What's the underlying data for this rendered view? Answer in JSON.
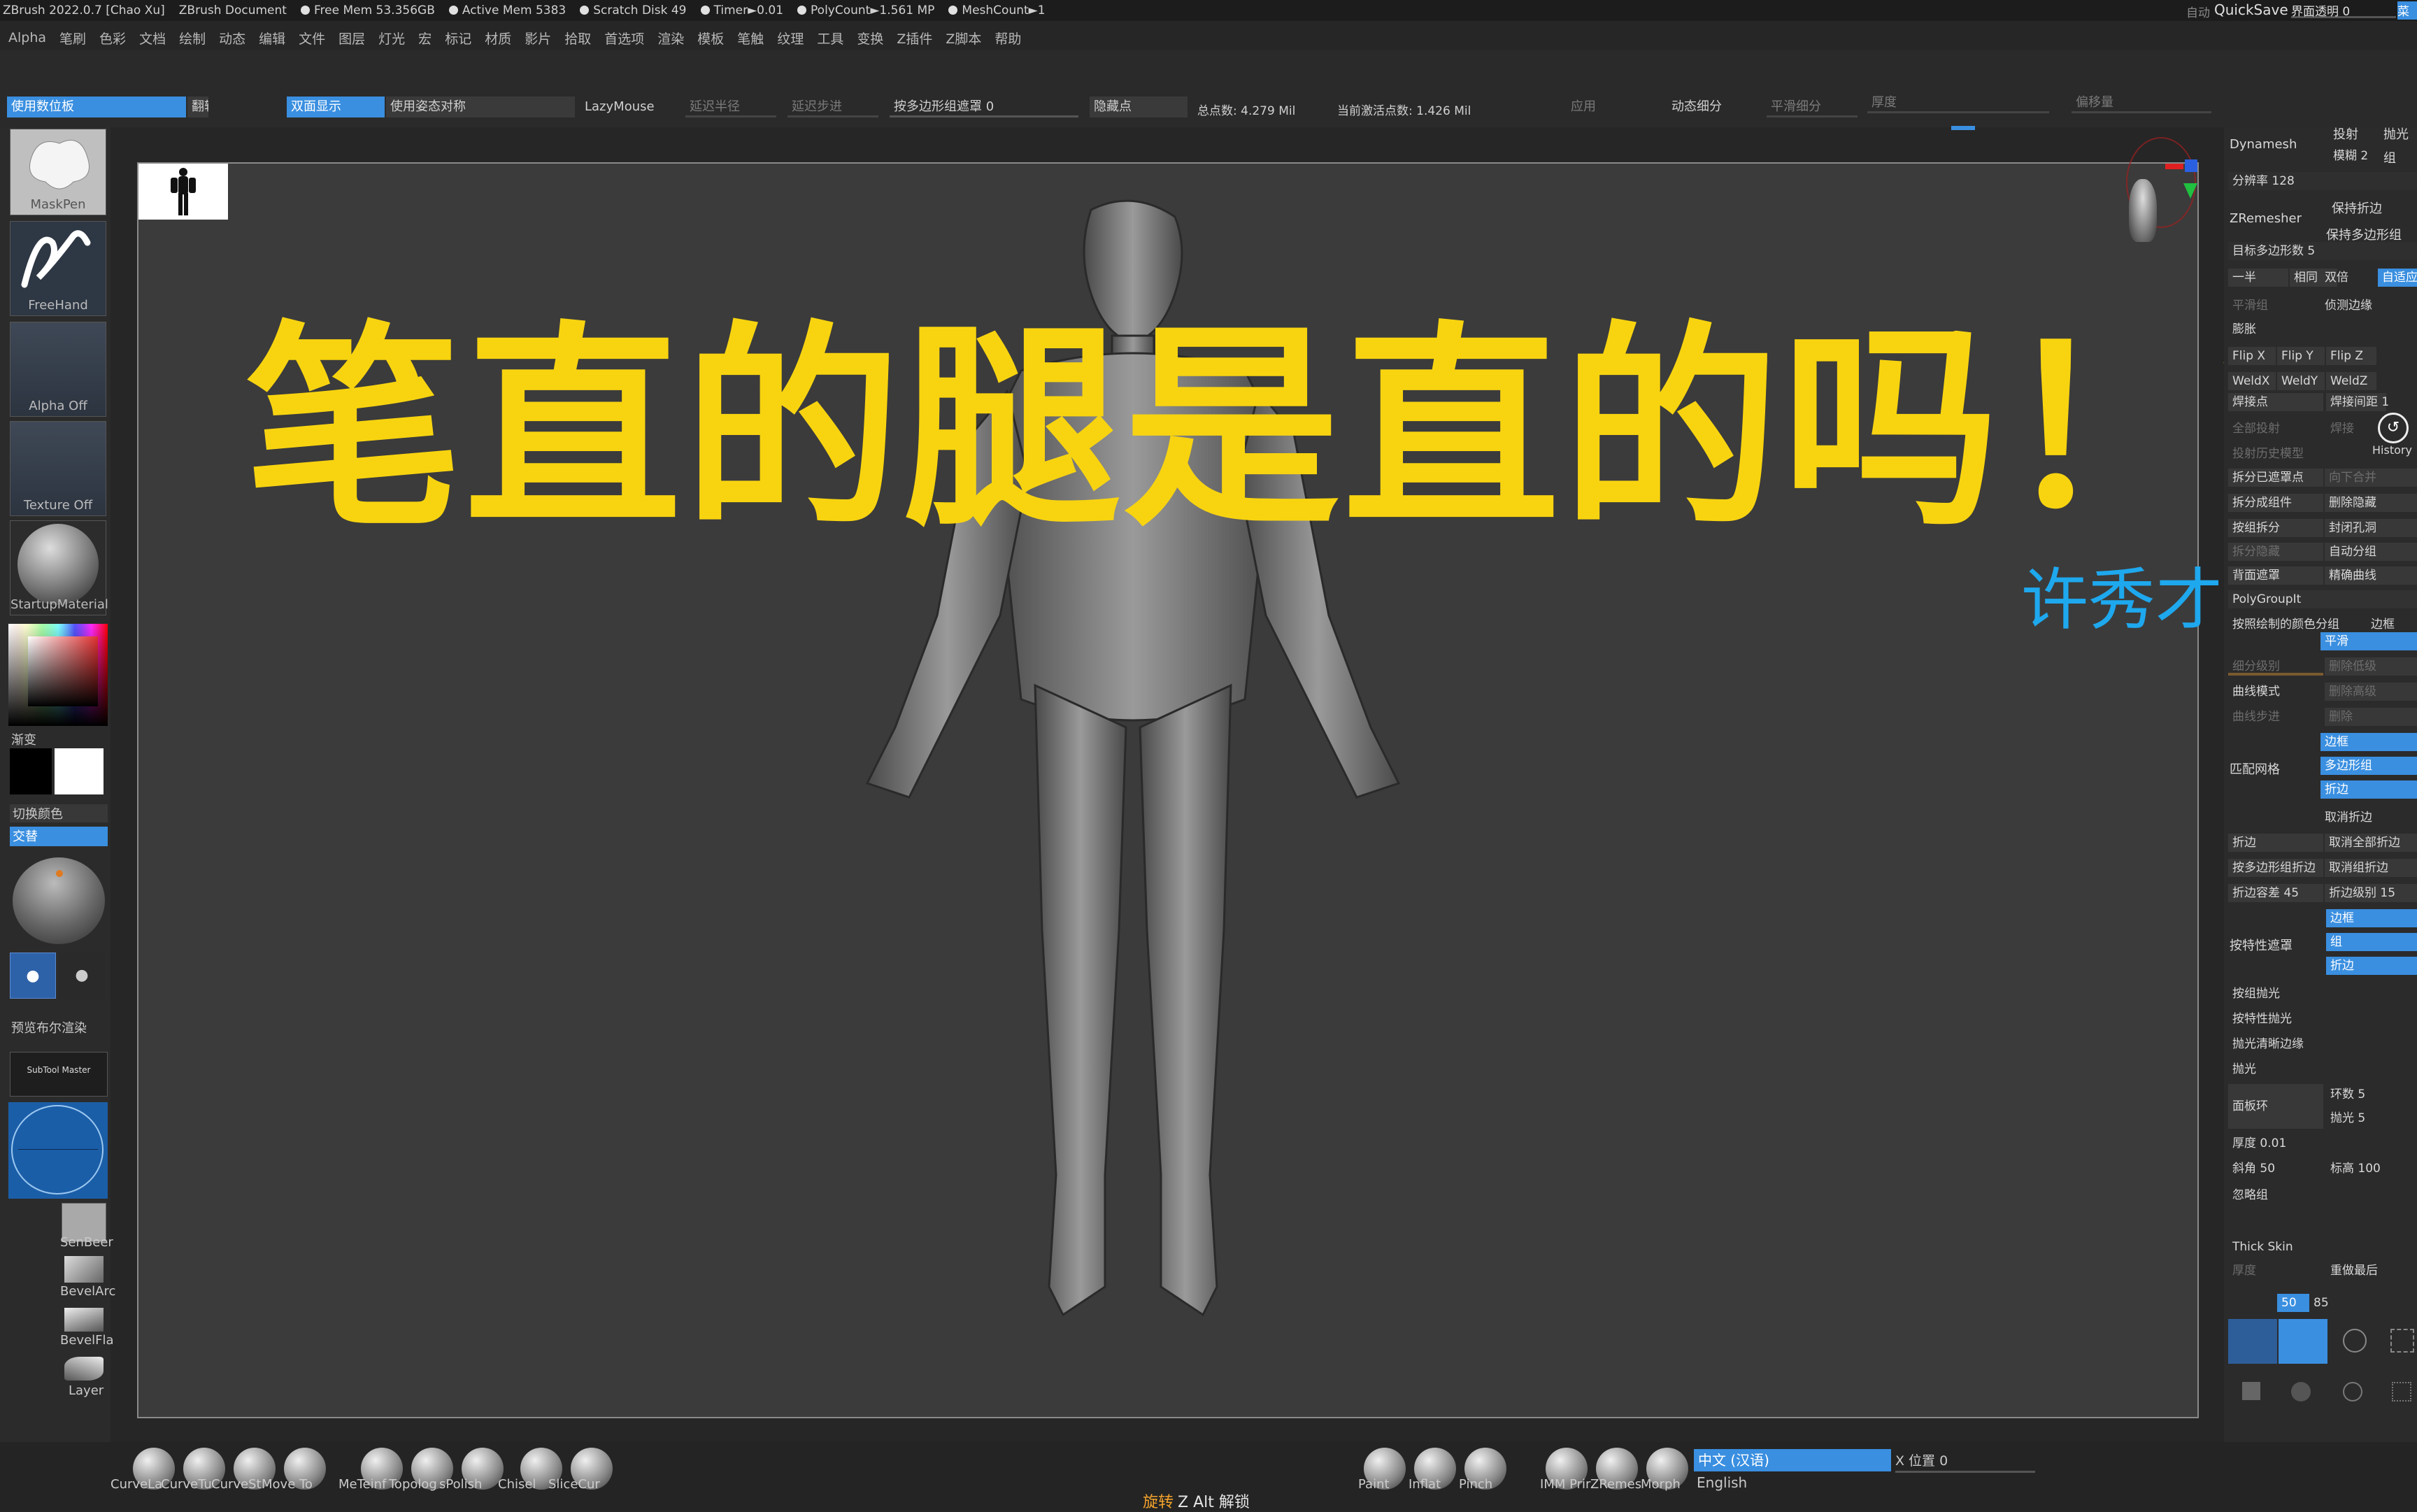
{
  "titlebar": {
    "app": "ZBrush 2022.0.7 [Chao Xu]",
    "document": "ZBrush Document",
    "free_mem": "Free Mem 53.356GB",
    "active_mem": "Active Mem 5383",
    "scratch_disk": "Scratch Disk 49",
    "timer": "Timer►0.01",
    "polycount": "PolyCount►1.561 MP",
    "meshcount": "MeshCount►1",
    "right_a": "自动",
    "quicksave": "QuickSave",
    "transparency": "界面透明 0",
    "menu": "菜单"
  },
  "menubar": [
    "Alpha",
    "笔刷",
    "色彩",
    "文档",
    "绘制",
    "动态",
    "编辑",
    "文件",
    "图层",
    "灯光",
    "宏",
    "标记",
    "材质",
    "影片",
    "拾取",
    "首选项",
    "渲染",
    "模板",
    "笔触",
    "纹理",
    "工具",
    "变换",
    "Z插件",
    "Z脚本",
    "帮助"
  ],
  "topshelf": {
    "use_tablet": "使用数位板",
    "flip": "翻转",
    "double_sided": "双面显示",
    "use_pose_sym": "使用姿态对称",
    "lazymouse": "LazyMouse",
    "lazy_radius": "延迟半径",
    "lazy_step": "延迟步进",
    "polygroup_mask": "按多边形组遮罩 0",
    "hide_points": "隐藏点",
    "total_points": "总点数: 4.279 Mil",
    "active_points": "当前激活点数: 1.426 Mil",
    "apply": "应用",
    "dynamic_subdiv": "动态细分",
    "smooth_subdiv": "平滑细分",
    "thickness": "厚度",
    "offset": "偏移量"
  },
  "leftpanel": {
    "brush1": "MaskPen",
    "brush2": "FreeHand",
    "alpha": "Alpha Off",
    "texture": "Texture Off",
    "material": "StartupMaterial",
    "gradient": "渐变",
    "switch_color": "切换颜色",
    "alternate": "交替",
    "bool_render": "预览布尔渲染",
    "subtool_master": "SubTool Master",
    "brushes": [
      "SenBeer",
      "BevelArc",
      "BevelFla",
      "Layer"
    ]
  },
  "headline": "笔直的腿是直的吗！？",
  "author": "许秀才",
  "rightpanel": {
    "dynamesh": "Dynamesh",
    "project": "投射",
    "polish": "抛光",
    "blur": "模糊 2",
    "group": "组",
    "resolution": "分辨率 128",
    "zremesher": "ZRemesher",
    "keep_creases": "保持折边",
    "keep_groups": "保持多边形组",
    "target_poly": "目标多边形数 5",
    "half": "一半",
    "same": "相同",
    "double": "双倍",
    "adapt": "自适应",
    "smooth_group": "平滑组",
    "detect_edges": "侦测边缘",
    "inflate": "膨胀",
    "flipx": "Flip X",
    "flipy": "Flip Y",
    "flipz": "Flip Z",
    "weldx": "WeldX",
    "weldy": "WeldY",
    "weldz": "WeldZ",
    "weld_points": "焊接点",
    "weld_dist": "焊接间距 1",
    "project_all": "全部投射",
    "weld": "焊接",
    "project_history": "投射历史模型",
    "history": "History",
    "split_masked": "拆分已遮罩点",
    "merge_down": "向下合并",
    "split_to_parts": "拆分成组件",
    "delete_hidden": "删除隐藏",
    "group_split": "按组拆分",
    "close_holes": "封闭孔洞",
    "split_hidden": "拆分隐藏",
    "auto_group": "自动分组",
    "backface_mask": "背面遮罩",
    "precise_curve": "精确曲线",
    "polygroupit": "PolyGroupIt",
    "polypaint_groups": "按照绘制的颜色分组",
    "border": "边框",
    "smooth": "平滑",
    "subdiv_level": "细分级别",
    "del_lower": "删除低级",
    "curve_mode": "曲线模式",
    "del_higher": "删除高级",
    "curve_step": "曲线步进",
    "delete": "删除",
    "match_mesh": "匹配网格",
    "border2": "边框",
    "polygroup": "多边形组",
    "crease_btn": "折边",
    "uncrease": "取消折边",
    "crease": "折边",
    "uncrease_all": "取消全部折边",
    "crease_pg": "按多边形组折边",
    "uncrease_group": "取消组折边",
    "crease_tol": "折边容差 45",
    "crease_level": "折边级别 15",
    "feature_mask": "按特性遮罩",
    "fm_border": "边框",
    "fm_group": "组",
    "fm_crease": "折边",
    "group_polish": "按组抛光",
    "feature_polish": "按特性抛光",
    "polish_crisp": "抛光清晰边缘",
    "polish2": "抛光",
    "panel_loops": "面板环",
    "loops": "环数 5",
    "polish_val": "抛光 5",
    "thick": "厚度 0.01",
    "bevel": "斜角 50",
    "elevation": "标高 100",
    "ignore_groups": "忽略组",
    "thick_skin": "Thick Skin",
    "thickness2": "厚度",
    "redo_last": "重做最后",
    "val50": "50",
    "val85": "85"
  },
  "bottombar": {
    "brushes_left": [
      "CurveLa",
      "CurveTu",
      "CurveSt",
      "Move To",
      "MeTeinf",
      "Topolog",
      "sPolish",
      "Chisel",
      "SliceCur"
    ],
    "brushes_right": [
      "Paint",
      "Inflat",
      "Pinch",
      "IMM Prir",
      "ZRemes",
      "Morph"
    ],
    "language": "中文 (汉语)",
    "english": "English",
    "xpos": "X 位置 0",
    "rotate_hint": "旋转",
    "rotate_rest": "Z Alt 解锁"
  },
  "colors": {
    "accent": "#3a8fe0",
    "headline": "#f8d410",
    "author": "#1ea8ee"
  }
}
